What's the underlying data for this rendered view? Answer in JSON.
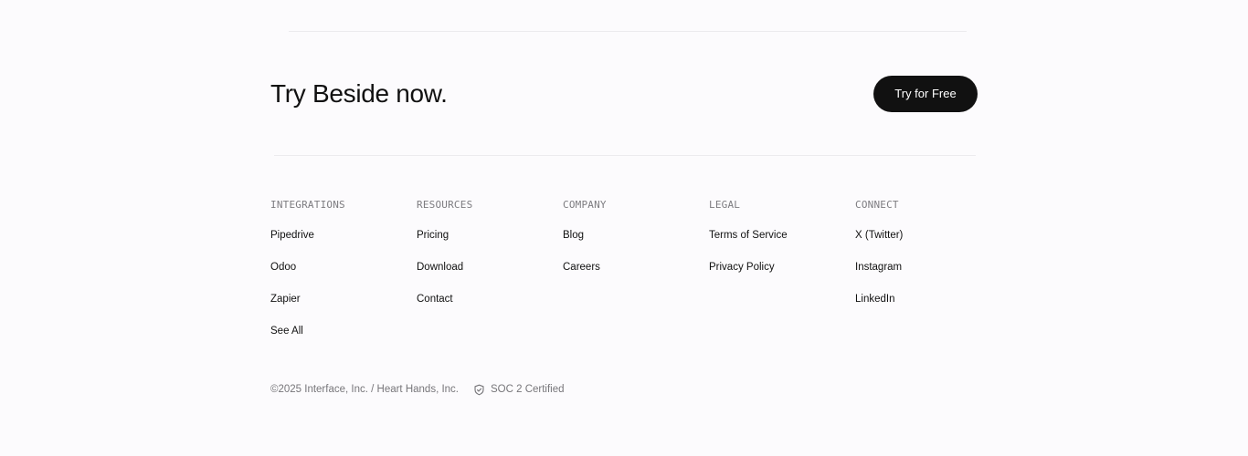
{
  "cta": {
    "heading": "Try Beside now.",
    "button_label": "Try for Free"
  },
  "footer": {
    "columns": [
      {
        "heading": "INTEGRATIONS",
        "links": [
          "Pipedrive",
          "Odoo",
          "Zapier",
          "See All"
        ]
      },
      {
        "heading": "RESOURCES",
        "links": [
          "Pricing",
          "Download",
          "Contact"
        ]
      },
      {
        "heading": "COMPANY",
        "links": [
          "Blog",
          "Careers"
        ]
      },
      {
        "heading": "LEGAL",
        "links": [
          "Terms of Service",
          "Privacy Policy"
        ]
      },
      {
        "heading": "CONNECT",
        "links": [
          "X (Twitter)",
          "Instagram",
          "LinkedIn"
        ]
      }
    ],
    "copyright": "©2025 Interface, Inc. / Heart Hands, Inc.",
    "certification": {
      "icon": "shield-check-icon",
      "label": "SOC 2 Certified"
    }
  },
  "colors": {
    "background": "#fcfbfd",
    "button_bg": "#111111",
    "button_text": "#ffffff",
    "muted_text": "#7d7c80"
  }
}
